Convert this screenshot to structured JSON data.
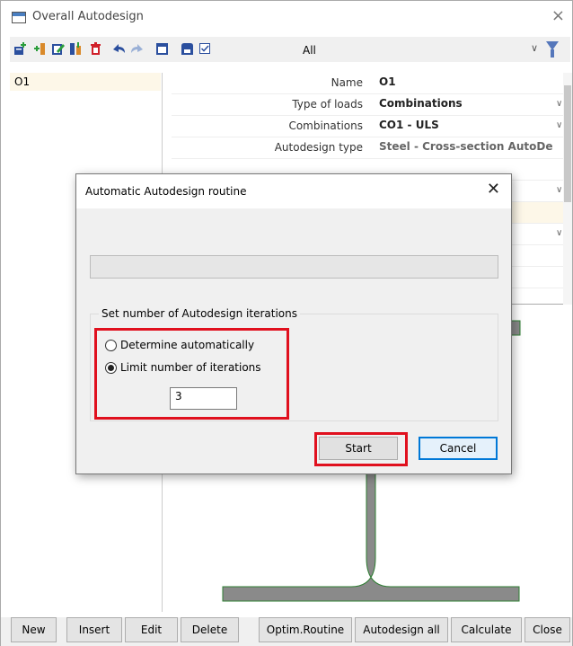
{
  "window": {
    "title": "Overall Autodesign",
    "close_glyph": "×"
  },
  "toolbar": {
    "filter_label": "All",
    "icons": [
      "add-icon",
      "insert-icon",
      "edit-icon",
      "copy-icon",
      "delete-icon",
      "undo-icon",
      "redo-icon",
      "table-icon",
      "save-icon",
      "checkbox-icon",
      "filter-icon"
    ]
  },
  "list": {
    "items": [
      "O1"
    ]
  },
  "properties": {
    "rows": [
      {
        "label": "Name",
        "value": "O1",
        "dropdown": false
      },
      {
        "label": "Type of loads",
        "value": "Combinations",
        "dropdown": true
      },
      {
        "label": "Combinations",
        "value": "CO1 - ULS",
        "dropdown": true
      },
      {
        "label": "Autodesign type",
        "value": "Steel - Cross-section AutoDe",
        "dropdown": false
      }
    ]
  },
  "buttons": {
    "new": "New",
    "insert": "Insert",
    "edit": "Edit",
    "delete": "Delete",
    "optim": "Optim.Routine",
    "autodesign_all": "Autodesign all",
    "calculate": "Calculate",
    "close": "Close"
  },
  "dialog": {
    "title": "Automatic Autodesign routine",
    "close_glyph": "✕",
    "group_title": "Set number of Autodesign iterations",
    "radio_auto": "Determine automatically",
    "radio_limit": "Limit number of iterations",
    "selected": "limit",
    "iterations": "3",
    "start": "Start",
    "cancel": "Cancel"
  },
  "colors": {
    "highlight": "#e0101e",
    "section_fill": "#8a8a8a",
    "section_stroke": "#2e7d32",
    "default_button_border": "#0078d7"
  }
}
